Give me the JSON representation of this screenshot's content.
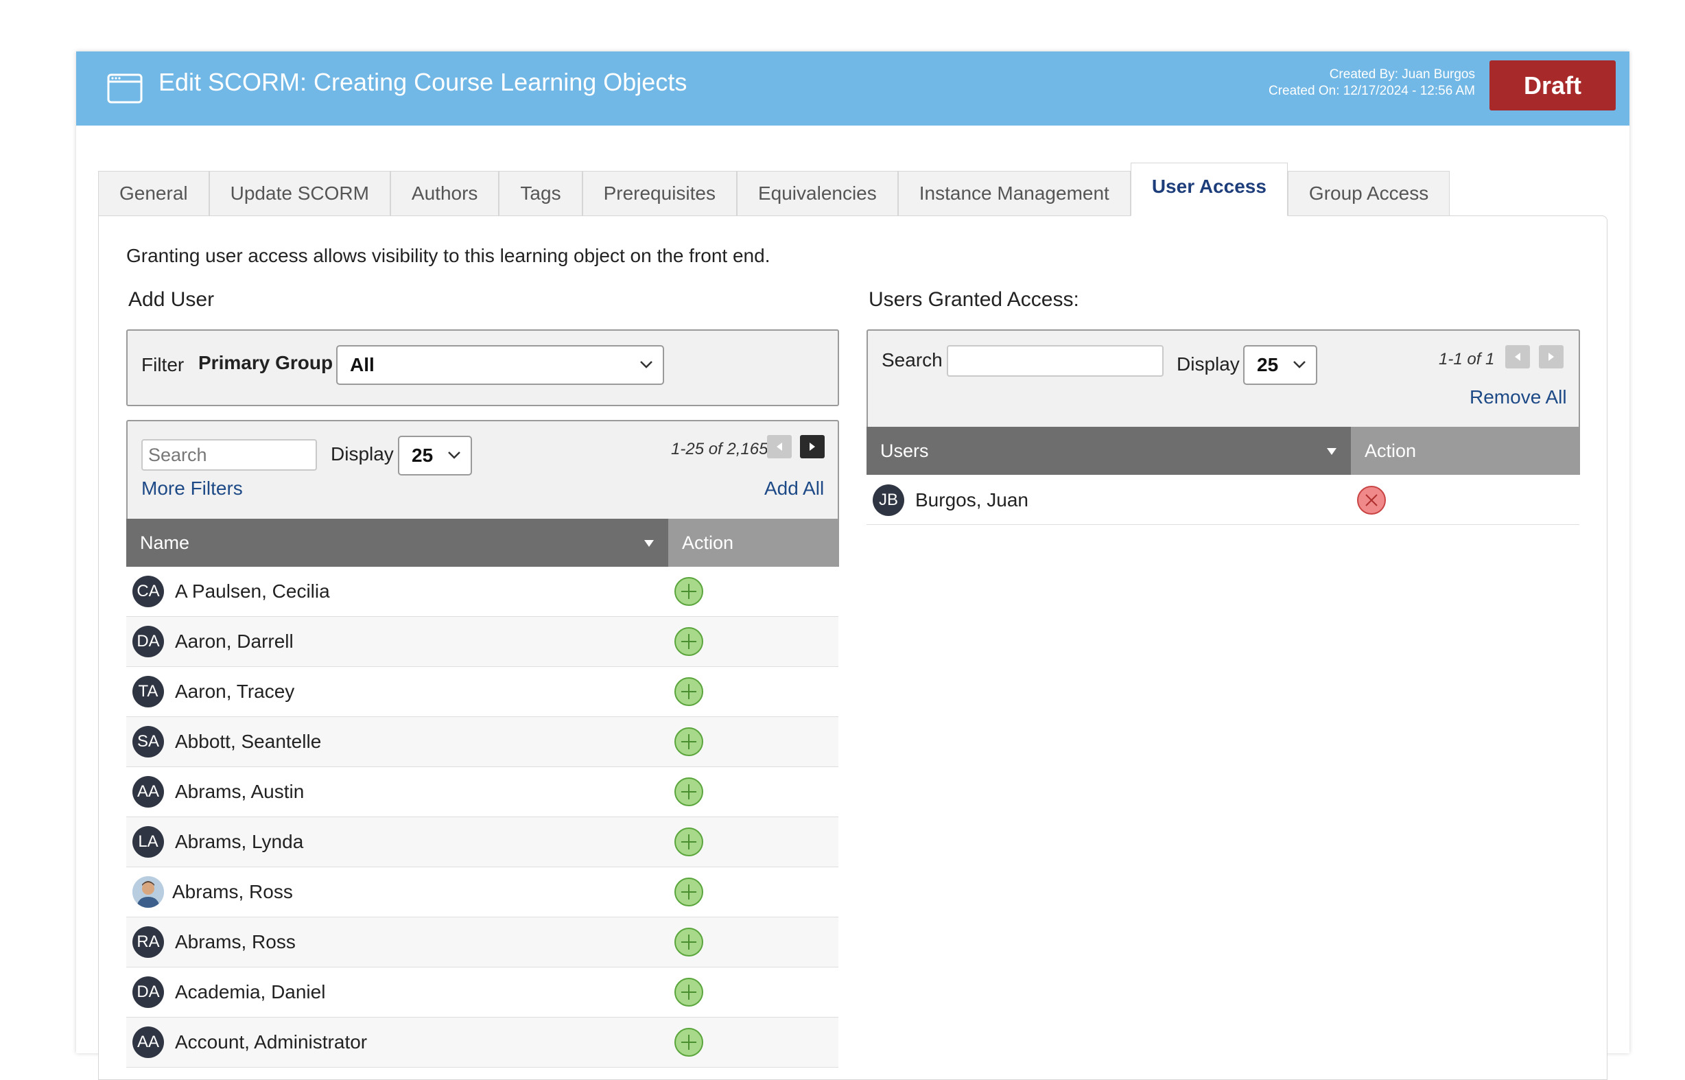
{
  "header": {
    "title": "Edit SCORM: Creating Course Learning Objects",
    "created_by": "Created By: Juan Burgos",
    "created_on": "Created On: 12/17/2024 - 12:56 AM",
    "status_button": "Draft",
    "colors": {
      "header_bg": "#72b8e6",
      "draft_bg": "#a8292a"
    }
  },
  "tabs": [
    {
      "label": "General"
    },
    {
      "label": "Update SCORM"
    },
    {
      "label": "Authors"
    },
    {
      "label": "Tags"
    },
    {
      "label": "Prerequisites"
    },
    {
      "label": "Equivalencies"
    },
    {
      "label": "Instance Management"
    },
    {
      "label": "User Access",
      "active": true
    },
    {
      "label": "Group Access"
    }
  ],
  "intro_text": "Granting user access allows visibility to this learning object on the front end.",
  "add_user": {
    "heading": "Add User",
    "filter_label": "Filter",
    "primary_group_label": "Primary Group",
    "primary_group_value": "All",
    "search_placeholder": "Search",
    "display_label": "Display",
    "display_value": "25",
    "pager": "1-25 of 2,165",
    "more_filters": "More Filters",
    "add_all": "Add All",
    "columns": {
      "name": "Name",
      "action": "Action"
    },
    "users": [
      {
        "initials": "CA",
        "name": "A Paulsen, Cecilia"
      },
      {
        "initials": "DA",
        "name": "Aaron, Darrell"
      },
      {
        "initials": "TA",
        "name": "Aaron, Tracey"
      },
      {
        "initials": "SA",
        "name": "Abbott, Seantelle"
      },
      {
        "initials": "AA",
        "name": "Abrams, Austin"
      },
      {
        "initials": "LA",
        "name": "Abrams, Lynda"
      },
      {
        "initials": "",
        "name": "Abrams, Ross",
        "photo": true
      },
      {
        "initials": "RA",
        "name": "Abrams, Ross"
      },
      {
        "initials": "DA",
        "name": "Academia, Daniel"
      },
      {
        "initials": "AA",
        "name": "Account, Administrator"
      }
    ]
  },
  "granted": {
    "heading": "Users Granted Access:",
    "search_label": "Search",
    "search_value": "",
    "display_label": "Display",
    "display_value": "25",
    "pager": "1-1 of 1",
    "remove_all": "Remove All",
    "columns": {
      "users": "Users",
      "action": "Action"
    },
    "users": [
      {
        "initials": "JB",
        "name": "Burgos, Juan"
      }
    ]
  }
}
